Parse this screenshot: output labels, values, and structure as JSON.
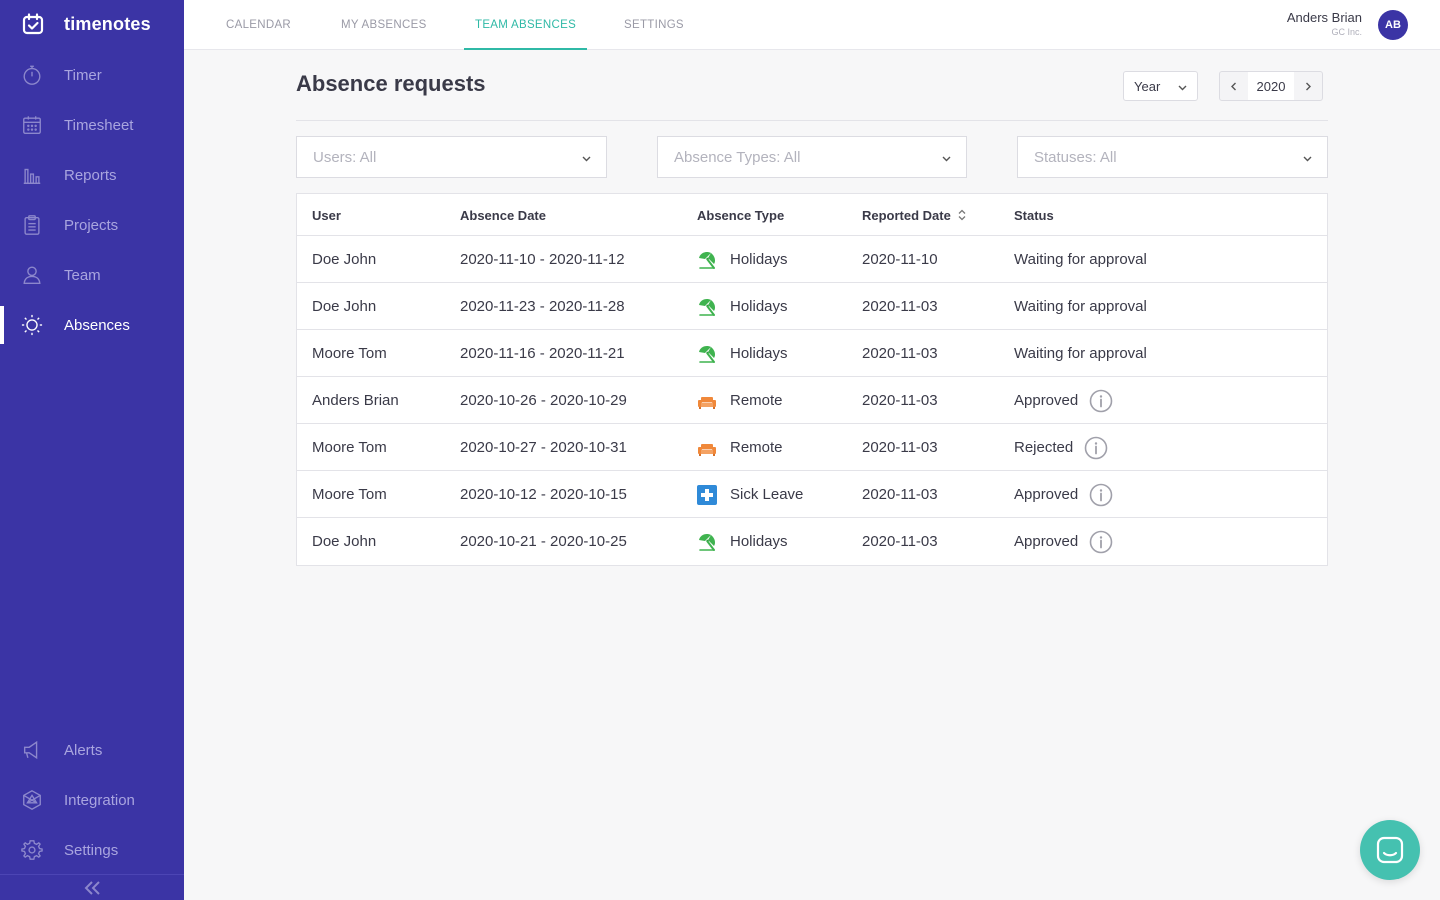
{
  "brand": {
    "name": "timenotes"
  },
  "sidebar": {
    "top_items": [
      {
        "label": "Timer",
        "icon": "stopwatch-icon"
      },
      {
        "label": "Timesheet",
        "icon": "calendar-grid-icon"
      },
      {
        "label": "Reports",
        "icon": "bar-chart-icon"
      },
      {
        "label": "Projects",
        "icon": "clipboard-icon"
      },
      {
        "label": "Team",
        "icon": "user-icon"
      },
      {
        "label": "Absences",
        "icon": "sun-icon",
        "active": true
      }
    ],
    "bottom_items": [
      {
        "label": "Alerts",
        "icon": "megaphone-icon"
      },
      {
        "label": "Integration",
        "icon": "integration-icon"
      },
      {
        "label": "Settings",
        "icon": "gear-icon"
      }
    ]
  },
  "topbar": {
    "tabs": [
      {
        "label": "CALENDAR"
      },
      {
        "label": "MY ABSENCES"
      },
      {
        "label": "TEAM ABSENCES",
        "active": true
      },
      {
        "label": "SETTINGS"
      }
    ],
    "user": {
      "name": "Anders Brian",
      "company": "GC Inc.",
      "initials": "AB"
    }
  },
  "main": {
    "title": "Absence requests",
    "period_select": "Year",
    "year": "2020",
    "filters": {
      "users": "Users: All",
      "absence_types": "Absence Types: All",
      "statuses": "Statuses: All"
    },
    "table": {
      "headers": {
        "user": "User",
        "absence_date": "Absence Date",
        "absence_type": "Absence Type",
        "reported_date": "Reported Date",
        "status": "Status"
      },
      "rows": [
        {
          "user": "Doe John",
          "absence_date": "2020-11-10 - 2020-11-12",
          "type": "Holidays",
          "type_icon": "umbrella-icon",
          "reported": "2020-11-10",
          "status": "Waiting for approval",
          "info": false
        },
        {
          "user": "Doe John",
          "absence_date": "2020-11-23 - 2020-11-28",
          "type": "Holidays",
          "type_icon": "umbrella-icon",
          "reported": "2020-11-03",
          "status": "Waiting for approval",
          "info": false
        },
        {
          "user": "Moore Tom",
          "absence_date": "2020-11-16 - 2020-11-21",
          "type": "Holidays",
          "type_icon": "umbrella-icon",
          "reported": "2020-11-03",
          "status": "Waiting for approval",
          "info": false
        },
        {
          "user": "Anders Brian",
          "absence_date": "2020-10-26 - 2020-10-29",
          "type": "Remote",
          "type_icon": "sofa-icon",
          "reported": "2020-11-03",
          "status": "Approved",
          "info": true
        },
        {
          "user": "Moore Tom",
          "absence_date": "2020-10-27 - 2020-10-31",
          "type": "Remote",
          "type_icon": "sofa-icon",
          "reported": "2020-11-03",
          "status": "Rejected",
          "info": true
        },
        {
          "user": "Moore Tom",
          "absence_date": "2020-10-12 - 2020-10-15",
          "type": "Sick Leave",
          "type_icon": "medical-cross-icon",
          "reported": "2020-11-03",
          "status": "Approved",
          "info": true
        },
        {
          "user": "Doe John",
          "absence_date": "2020-10-21 - 2020-10-25",
          "type": "Holidays",
          "type_icon": "umbrella-icon",
          "reported": "2020-11-03",
          "status": "Approved",
          "info": true
        }
      ]
    }
  },
  "colors": {
    "sidebar_bg": "#3b34a5",
    "accent": "#2fb9a6",
    "holidays": "#3fb34f",
    "remote": "#f0883a",
    "sick_leave": "#2f8ad8",
    "chat_bubble": "#45c1b0"
  }
}
